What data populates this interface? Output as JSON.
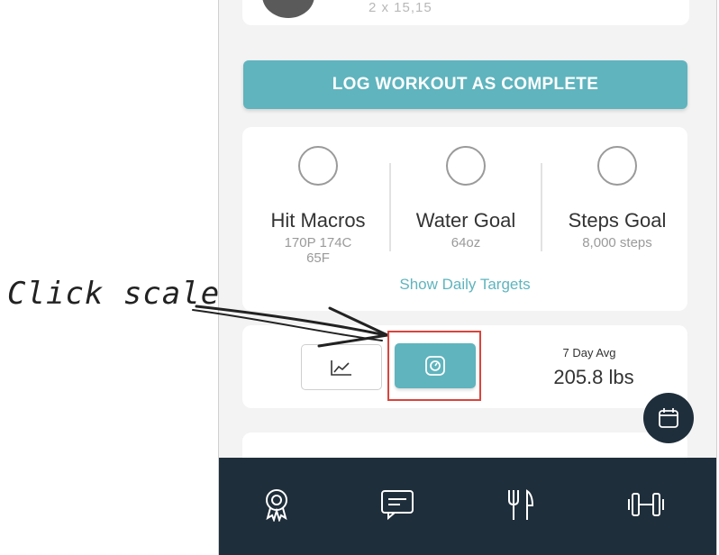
{
  "workout": {
    "sets_text": "2 x 15,15",
    "log_button": "LOG WORKOUT AS COMPLETE"
  },
  "goals": [
    {
      "title": "Hit Macros",
      "sub": "170P  174C\n65F"
    },
    {
      "title": "Water Goal",
      "sub": "64oz"
    },
    {
      "title": "Steps Goal",
      "sub": "8,000 steps"
    }
  ],
  "show_targets_link": "Show Daily Targets",
  "weight": {
    "avg_label": "7 Day Avg",
    "avg_value": "205.8 lbs"
  },
  "annotation": {
    "text": "Click scale"
  },
  "colors": {
    "accent": "#5fb4be",
    "nav_bg": "#1f2e3b",
    "highlight": "#d9443c"
  },
  "icons": {
    "graph": "line-chart-icon",
    "scale": "scale-icon",
    "calendar": "calendar-icon",
    "nav": [
      "award-icon",
      "chat-icon",
      "fork-knife-icon",
      "dumbbell-icon"
    ]
  }
}
